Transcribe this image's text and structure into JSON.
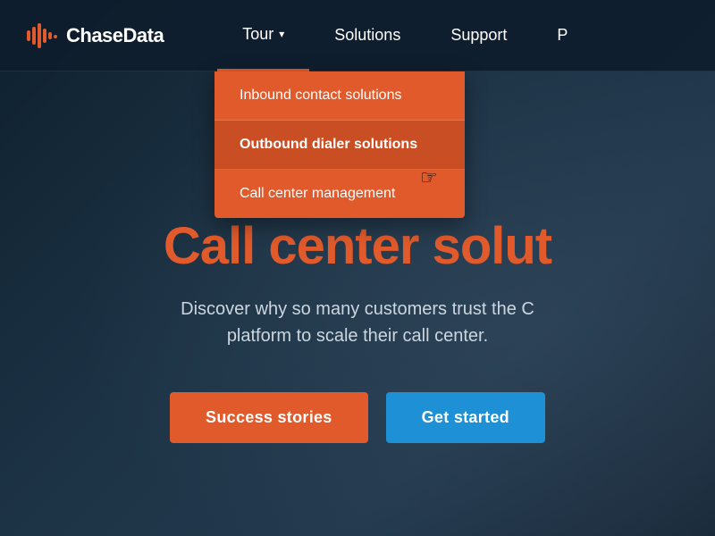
{
  "brand": {
    "logo_text": "ChaseData",
    "logo_icon": "📶"
  },
  "navbar": {
    "items": [
      {
        "label": "Tour",
        "active": true,
        "has_dropdown": true
      },
      {
        "label": "Solutions",
        "active": false,
        "has_dropdown": false
      },
      {
        "label": "Support",
        "active": false,
        "has_dropdown": false
      },
      {
        "label": "P",
        "active": false,
        "has_dropdown": false
      }
    ]
  },
  "dropdown": {
    "items": [
      {
        "label": "Inbound contact solutions",
        "highlighted": false
      },
      {
        "label": "Outbound dialer solutions",
        "highlighted": true
      },
      {
        "label": "Call center management",
        "highlighted": false
      }
    ]
  },
  "hero": {
    "title": "Call center solut",
    "subtitle_line1": "Discover why so many customers trust the C",
    "subtitle_line2": "platform to scale their call center.",
    "btn_success": "Success stories",
    "btn_started": "Get started"
  },
  "colors": {
    "accent": "#e05a2b",
    "blue": "#1e90d6",
    "text_light": "#ccd6e0"
  }
}
